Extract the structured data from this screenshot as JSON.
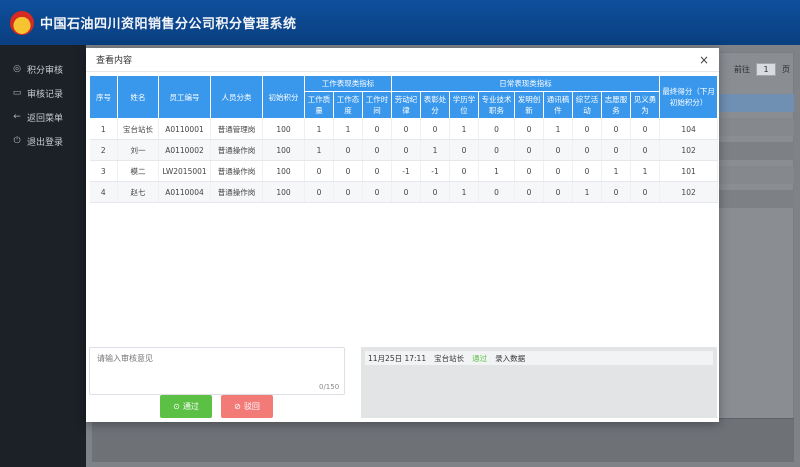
{
  "app": {
    "title": "中国石油四川资阳销售分公司积分管理系统"
  },
  "sidebar": {
    "items": [
      {
        "icon": "compass-icon",
        "label": "积分审核"
      },
      {
        "icon": "folder-icon",
        "label": "审核记录"
      },
      {
        "icon": "arrow-left-icon",
        "label": "返回菜单"
      },
      {
        "icon": "power-icon",
        "label": "退出登录"
      }
    ]
  },
  "pager": {
    "goto_label": "前往",
    "page": "1",
    "page_suffix": "页"
  },
  "modal": {
    "title": "查看内容",
    "close": "×",
    "headers": {
      "index": "序号",
      "name": "姓名",
      "employee_id": "员工编号",
      "category": "人员分类",
      "initial": "初始积分",
      "work_group": "工作表现类指标",
      "daily_group": "日常表现类指标",
      "work_quality": "工作质量",
      "work_attitude": "工作态度",
      "work_time": "工作时间",
      "discipline": "劳动纪律",
      "reward": "表彰处分",
      "education": "学历学位",
      "tech_title": "专业技术职务",
      "innovation": "发明创新",
      "news": "通讯稿件",
      "culture": "综艺活动",
      "volunteer": "志愿服务",
      "bravery": "见义勇为",
      "final": "最终得分（下月初始积分）"
    },
    "rows": [
      {
        "index": "1",
        "name": "宝台站长",
        "employee_id": "A0110001",
        "category": "普通管理岗",
        "initial": "100",
        "work_quality": "1",
        "work_attitude": "1",
        "work_time": "0",
        "discipline": "0",
        "reward": "0",
        "education": "1",
        "tech_title": "0",
        "innovation": "0",
        "news": "1",
        "culture": "0",
        "volunteer": "0",
        "bravery": "0",
        "final": "104"
      },
      {
        "index": "2",
        "name": "刘一",
        "employee_id": "A0110002",
        "category": "普通操作岗",
        "initial": "100",
        "work_quality": "1",
        "work_attitude": "0",
        "work_time": "0",
        "discipline": "0",
        "reward": "1",
        "education": "0",
        "tech_title": "0",
        "innovation": "0",
        "news": "0",
        "culture": "0",
        "volunteer": "0",
        "bravery": "0",
        "final": "102"
      },
      {
        "index": "3",
        "name": "模二",
        "employee_id": "LW2015001",
        "category": "普通操作岗",
        "initial": "100",
        "work_quality": "0",
        "work_attitude": "0",
        "work_time": "0",
        "discipline": "-1",
        "reward": "-1",
        "education": "0",
        "tech_title": "1",
        "innovation": "0",
        "news": "0",
        "culture": "0",
        "volunteer": "1",
        "bravery": "1",
        "final": "101"
      },
      {
        "index": "4",
        "name": "赵七",
        "employee_id": "A0110004",
        "category": "普通操作岗",
        "initial": "100",
        "work_quality": "0",
        "work_attitude": "0",
        "work_time": "0",
        "discipline": "0",
        "reward": "0",
        "education": "1",
        "tech_title": "0",
        "innovation": "0",
        "news": "0",
        "culture": "1",
        "volunteer": "0",
        "bravery": "0",
        "final": "102"
      }
    ],
    "opinion": {
      "placeholder": "请输入审核意见",
      "counter": "0/150"
    },
    "buttons": {
      "pass": "通过",
      "reject": "驳回"
    },
    "log": {
      "time": "11月25日 17:11",
      "user": "宝台站长",
      "status": "通过",
      "action": "录入数据"
    }
  },
  "colors": {
    "header": "#0e4f9c",
    "table_header": "#3a98ec",
    "pass": "#5cc045",
    "reject": "#f27b78"
  }
}
